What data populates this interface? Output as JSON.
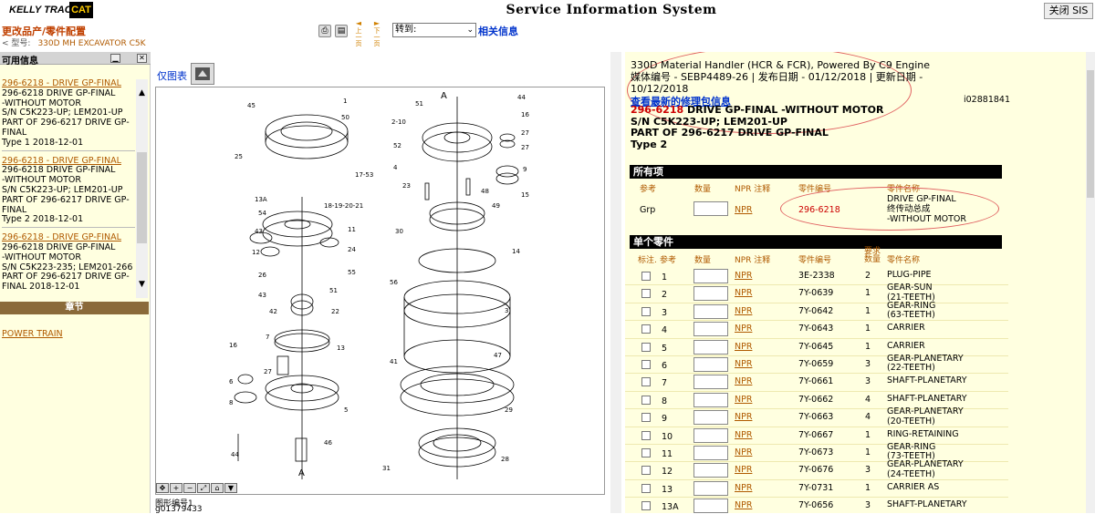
{
  "header": {
    "brand_kelly": "KELLY TRACTOR",
    "brand_cat": "CAT",
    "change_product": "更改品产/零件配置",
    "model_prefix": "< 型号:",
    "model": "330D MH EXCAVATOR C5K",
    "app_title": "Service Information System",
    "close_button": "关闭 SIS",
    "prev_page": "上一页",
    "next_page": "下一页",
    "goto_label": "转到:",
    "related_packages": "相关信息"
  },
  "left_panel": {
    "title": "可用信息",
    "items": [
      {
        "link": "296-6218 - DRIVE GP-FINAL",
        "lines": [
          "296-6218 DRIVE GP-FINAL",
          "-WITHOUT MOTOR",
          "S/N C5K223-UP; LEM201-UP",
          "PART OF 296-6217 DRIVE GP-",
          "FINAL",
          "Type 1 2018-12-01"
        ]
      },
      {
        "link": "296-6218 - DRIVE GP-FINAL",
        "lines": [
          "296-6218 DRIVE GP-FINAL",
          "-WITHOUT MOTOR",
          "S/N C5K223-UP; LEM201-UP",
          "PART OF 296-6217 DRIVE GP-",
          "FINAL",
          "Type 2 2018-12-01"
        ]
      },
      {
        "link": "296-6218 - DRIVE GP-FINAL",
        "lines": [
          "296-6218 DRIVE GP-FINAL",
          "-WITHOUT MOTOR",
          "S/N C5K223-235; LEM201-266",
          "PART OF 296-6217 DRIVE GP-",
          "FINAL 2018-12-01"
        ]
      }
    ],
    "chapter": "章节",
    "chapter_link": "POWER TRAIN"
  },
  "center": {
    "illustration_label": "仅图表",
    "figure_label": "图形编号1",
    "figure_number": "g01379433"
  },
  "right_panel": {
    "title": "330D Material Handler (HCR & FCR), Powered By C9 Engine",
    "media_line": "媒体编号 - SEBP4489-26    |    发布日期 - 01/12/2018    |    更新日期 - 10/12/2018",
    "latest_link": "查看最新的修理包信息",
    "illus_id": "i02881841",
    "part_number": "296-6218",
    "part_desc": " DRIVE GP-FINAL -WITHOUT MOTOR",
    "serial": "S/N C5K223-UP; LEM201-UP",
    "part_of": "PART OF 296-6217 DRIVE GP-FINAL",
    "type": "Type 2",
    "all_items_title": "所有项",
    "all_cols": {
      "ref": "参考",
      "qty": "数量",
      "npr": "NPR 注释",
      "pn": "零件编号",
      "name": "零件名称"
    },
    "grp_row": {
      "ref": "Grp",
      "npr": "NPR",
      "pn": "296-6218",
      "name": [
        "DRIVE GP-FINAL",
        "终传动总成",
        "-WITHOUT MOTOR"
      ]
    },
    "single_title": "单个零件",
    "single_cols": {
      "mark": "标注.",
      "ref": "参考",
      "qty": "数量",
      "npr": "NPR 注释",
      "pn": "零件编号",
      "req_qty": "要求数量",
      "name": "零件名称"
    },
    "parts": [
      {
        "ref": "1",
        "npr": "NPR",
        "pn": "3E-2338",
        "q": "2",
        "name": [
          "PLUG-PIPE"
        ]
      },
      {
        "ref": "2",
        "npr": "NPR",
        "pn": "7Y-0639",
        "q": "1",
        "name": [
          "GEAR-SUN",
          "(21-TEETH)"
        ]
      },
      {
        "ref": "3",
        "npr": "NPR",
        "pn": "7Y-0642",
        "q": "1",
        "name": [
          "GEAR-RING",
          "(63-TEETH)"
        ]
      },
      {
        "ref": "4",
        "npr": "NPR",
        "pn": "7Y-0643",
        "q": "1",
        "name": [
          "CARRIER"
        ]
      },
      {
        "ref": "5",
        "npr": "NPR",
        "pn": "7Y-0645",
        "q": "1",
        "name": [
          "CARRIER"
        ]
      },
      {
        "ref": "6",
        "npr": "NPR",
        "pn": "7Y-0659",
        "q": "3",
        "name": [
          "GEAR-PLANETARY",
          "(22-TEETH)"
        ]
      },
      {
        "ref": "7",
        "npr": "NPR",
        "pn": "7Y-0661",
        "q": "3",
        "name": [
          "SHAFT-PLANETARY"
        ]
      },
      {
        "ref": "8",
        "npr": "NPR",
        "pn": "7Y-0662",
        "q": "4",
        "name": [
          "SHAFT-PLANETARY"
        ]
      },
      {
        "ref": "9",
        "npr": "NPR",
        "pn": "7Y-0663",
        "q": "4",
        "name": [
          "GEAR-PLANETARY",
          "(20-TEETH)"
        ]
      },
      {
        "ref": "10",
        "npr": "NPR",
        "pn": "7Y-0667",
        "q": "1",
        "name": [
          "RING-RETAINING"
        ]
      },
      {
        "ref": "11",
        "npr": "NPR",
        "pn": "7Y-0673",
        "q": "1",
        "name": [
          "GEAR-RING",
          "(73-TEETH)"
        ]
      },
      {
        "ref": "12",
        "npr": "NPR",
        "pn": "7Y-0676",
        "q": "3",
        "name": [
          "GEAR-PLANETARY",
          "(24-TEETH)"
        ]
      },
      {
        "ref": "13",
        "npr": "NPR",
        "pn": "7Y-0731",
        "q": "1",
        "name": [
          "CARRIER AS"
        ]
      },
      {
        "ref": "13A",
        "npr": "NPR",
        "pn": "7Y-0656",
        "q": "3",
        "name": [
          "  SHAFT-PLANETARY"
        ]
      }
    ]
  }
}
